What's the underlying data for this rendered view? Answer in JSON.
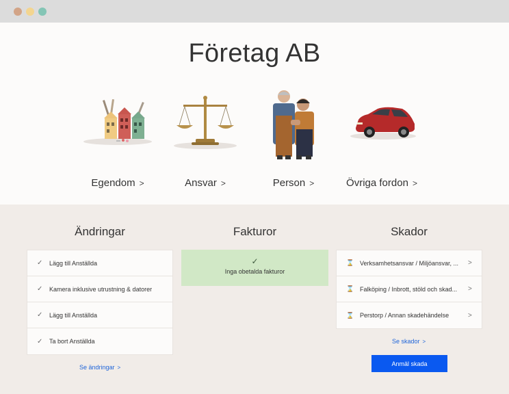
{
  "company": {
    "name": "Företag AB"
  },
  "categories": [
    {
      "label": "Egendom",
      "icon": "houses-illustration"
    },
    {
      "label": "Ansvar",
      "icon": "scales-illustration"
    },
    {
      "label": "Person",
      "icon": "people-illustration"
    },
    {
      "label": "Övriga fordon",
      "icon": "car-illustration"
    }
  ],
  "changes": {
    "title": "Ändringar",
    "items": [
      {
        "label": "Lägg till Anställda"
      },
      {
        "label": "Kamera inklusive utrustning & datorer"
      },
      {
        "label": "Lägg till Anställda"
      },
      {
        "label": "Ta bort Anställda"
      }
    ],
    "link": "Se ändringar"
  },
  "invoices": {
    "title": "Fakturor",
    "message": "Inga obetalda fakturor"
  },
  "claims": {
    "title": "Skador",
    "items": [
      {
        "label": "Verksamhetsansvar / Miljöansvar, ..."
      },
      {
        "label": "Falköping / Inbrott, stöld och skad..."
      },
      {
        "label": "Perstorp / Annan skadehändelse"
      }
    ],
    "link": "Se skador",
    "button": "Anmäl skada"
  },
  "colors": {
    "accent": "#0a59f0",
    "link": "#1e64d9",
    "success_bg": "#d1e8c6"
  }
}
